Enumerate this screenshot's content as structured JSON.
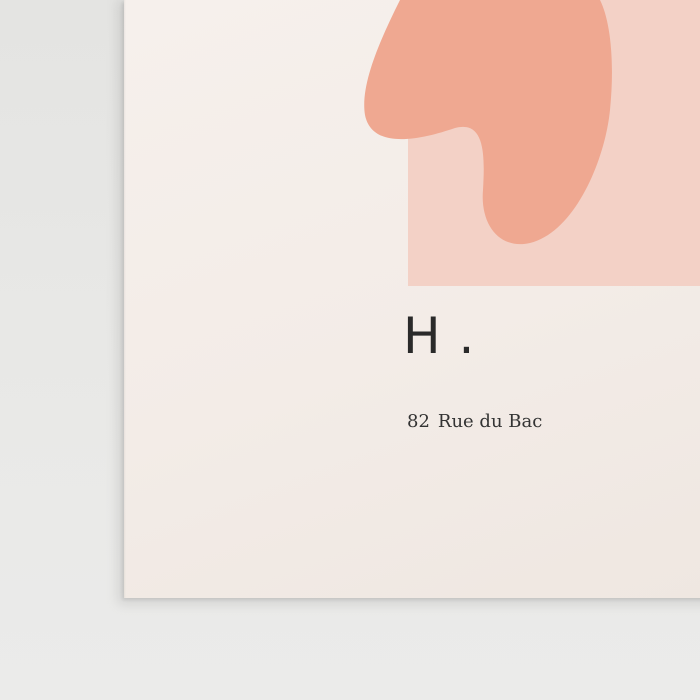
{
  "poster": {
    "title": "H .",
    "address_number": "82",
    "address_street": "Rue du Bac"
  },
  "colors": {
    "wall": "#e6e6e4",
    "paper": "#f4eee9",
    "panel": "#f3d1c6",
    "blob": "#efa891",
    "text": "#2a2a2a"
  }
}
